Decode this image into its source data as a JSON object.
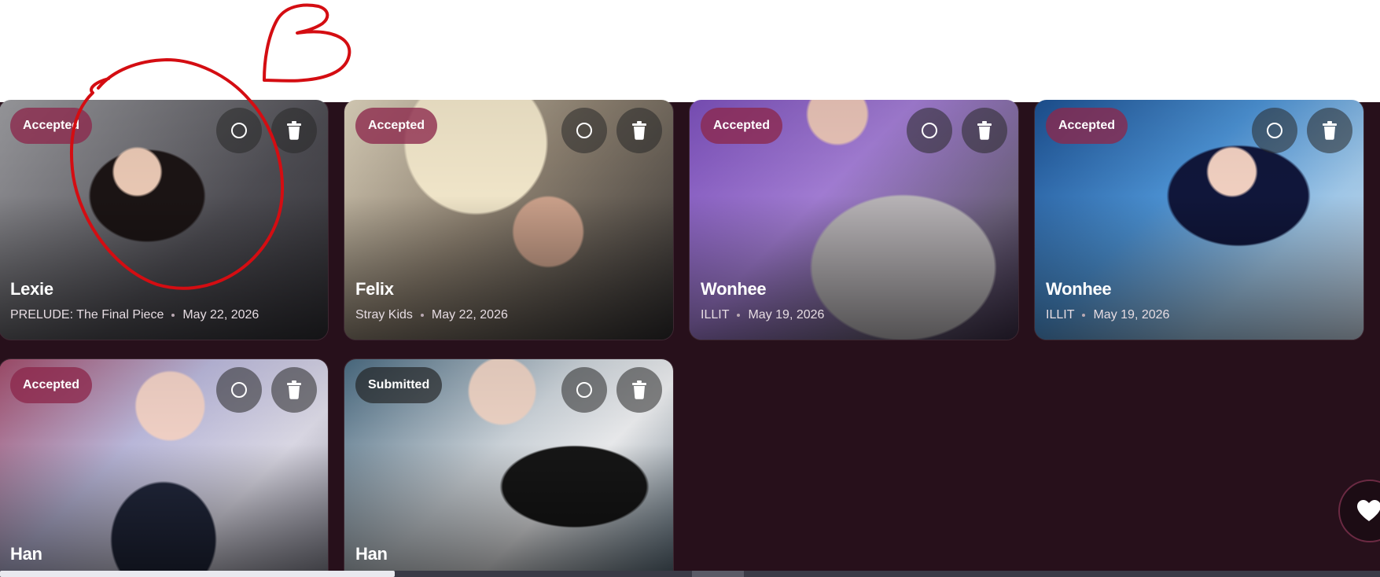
{
  "cards": [
    {
      "status": "Accepted",
      "name": "Lexie",
      "group": "PRELUDE: The Final Piece",
      "date": "May 22, 2026"
    },
    {
      "status": "Accepted",
      "name": "Felix",
      "group": "Stray Kids",
      "date": "May 22, 2026"
    },
    {
      "status": "Accepted",
      "name": "Wonhee",
      "group": "ILLIT",
      "date": "May 19, 2026"
    },
    {
      "status": "Accepted",
      "name": "Wonhee",
      "group": "ILLIT",
      "date": "May 19, 2026"
    },
    {
      "status": "Accepted",
      "name": "Han"
    },
    {
      "status": "Submitted",
      "name": "Han"
    }
  ],
  "icons": {
    "select": "circle-outline-icon",
    "delete": "trash-icon",
    "favorite": "heart-icon"
  },
  "colors": {
    "page_background": "#27101b",
    "badge": "#8c284b",
    "annotation": "#d40d12"
  }
}
